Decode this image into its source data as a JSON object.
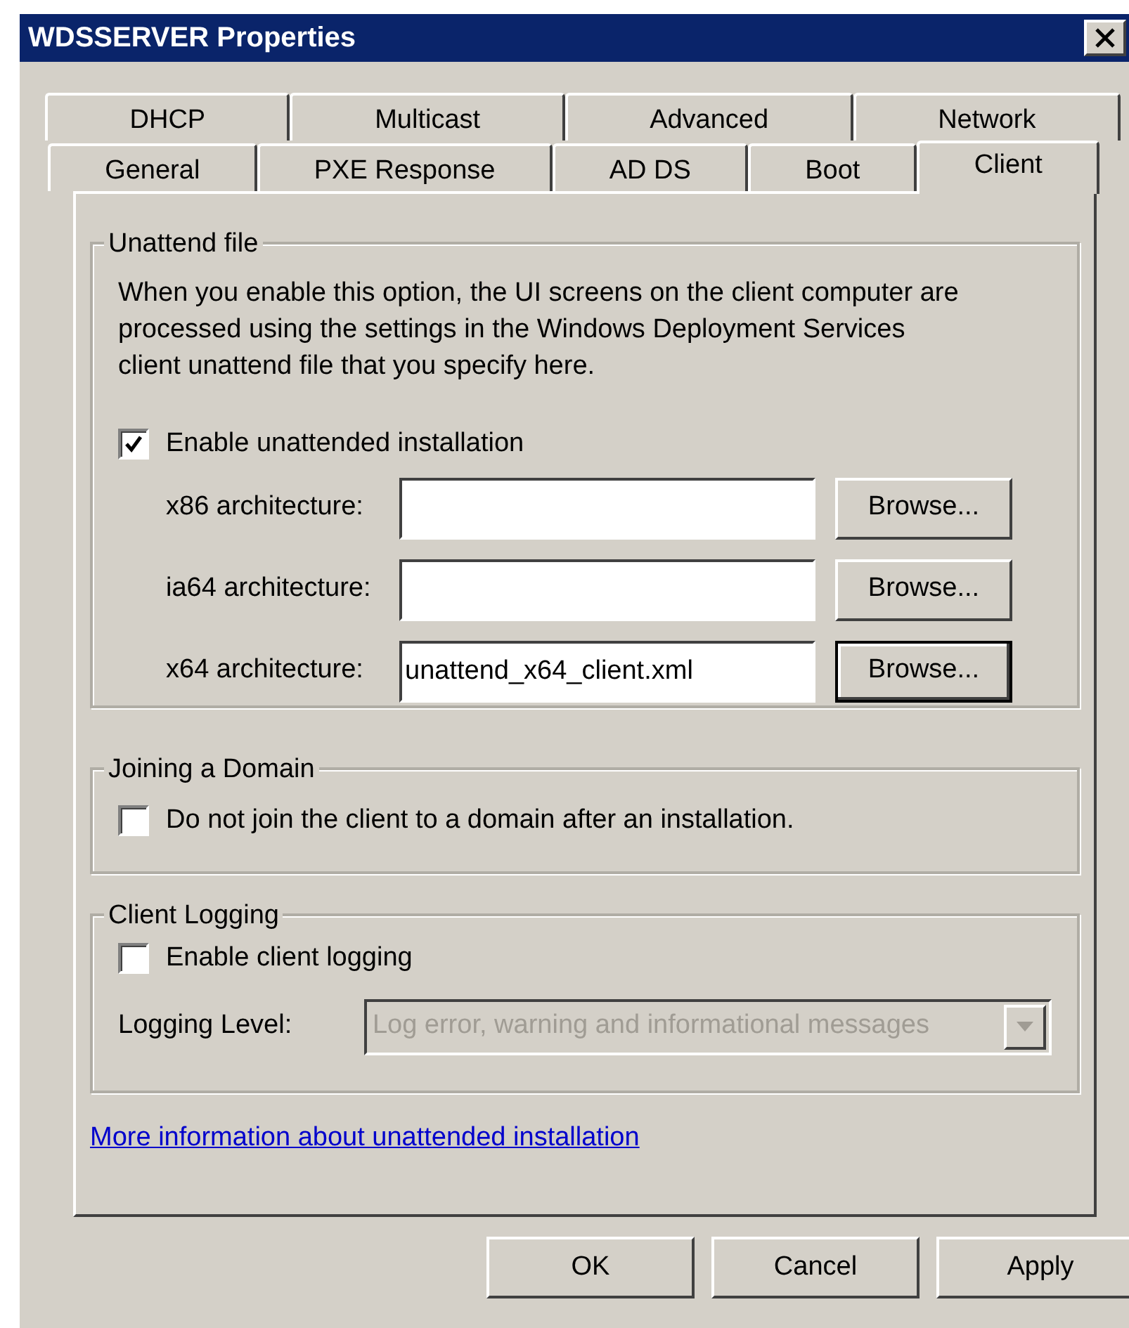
{
  "window": {
    "title": "WDSSERVER Properties"
  },
  "tab_rows": [
    {
      "tabs": [
        {
          "label": "DHCP",
          "selected": false
        },
        {
          "label": "Multicast",
          "selected": false
        },
        {
          "label": "Advanced",
          "selected": false
        },
        {
          "label": "Network",
          "selected": false
        }
      ]
    },
    {
      "tabs": [
        {
          "label": "General",
          "selected": false
        },
        {
          "label": "PXE Response",
          "selected": false
        },
        {
          "label": "AD DS",
          "selected": false
        },
        {
          "label": "Boot",
          "selected": false
        },
        {
          "label": "Client",
          "selected": true
        }
      ]
    }
  ],
  "unattend_file": {
    "title": "Unattend file",
    "description": "When you enable this option, the UI screens on the client computer are processed using the settings in the Windows Deployment Services client unattend file that you specify here.",
    "checkbox": {
      "label": "Enable unattended installation",
      "checked": true
    },
    "architectures": [
      {
        "label": "x86 architecture:",
        "button": "Browse...",
        "default": false
      },
      {
        "label": "ia64 architecture:",
        "button": "Browse...",
        "default": false
      },
      {
        "label": "x64 architecture:",
        "value": "unattend_x64_client.xml",
        "button": "Browse...",
        "default": true
      }
    ]
  },
  "joining_domain": {
    "title": "Joining a Domain",
    "checkbox": {
      "label": "Do not join the client to a domain after an installation.",
      "checked": false
    }
  },
  "client_logging": {
    "title": "Client Logging",
    "checkbox": {
      "label": "Enable client logging",
      "checked": false
    },
    "logging_level": {
      "label": "Logging Level:",
      "value": "Log error, warning and informational messages",
      "disabled": true
    }
  },
  "link": "More information about unattended installation",
  "buttons": [
    {
      "label": "OK"
    },
    {
      "label": "Cancel"
    },
    {
      "label": "Apply"
    }
  ]
}
